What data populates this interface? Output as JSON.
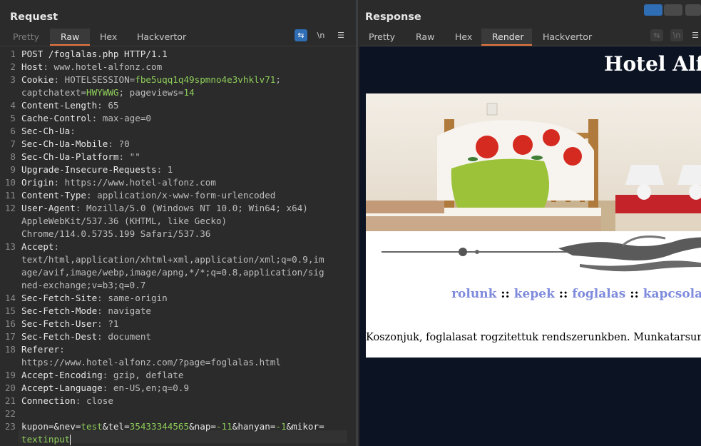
{
  "request": {
    "title": "Request",
    "tabs": [
      "Pretty",
      "Raw",
      "Hex",
      "Hackvertor"
    ],
    "active_tab": "Raw",
    "toolbar": {
      "wrap_icon": "wrap-lines-icon",
      "newline_label": "\\n",
      "menu_icon": "hamburger-menu-icon"
    },
    "lines": [
      {
        "n": "1",
        "segments": [
          {
            "t": "POST /foglalas.php HTTP/1.1",
            "c": "k"
          }
        ]
      },
      {
        "n": "2",
        "segments": [
          {
            "t": "Host",
            "c": "k"
          },
          {
            "t": ": www.hotel-alfonz.com",
            "c": "v"
          }
        ]
      },
      {
        "n": "3",
        "segments": [
          {
            "t": "Cookie",
            "c": "k"
          },
          {
            "t": ": HOTELSESSION=",
            "c": "v"
          },
          {
            "t": "fbe5uqq1q49spmno4e3vhklv71",
            "c": "g"
          },
          {
            "t": ";",
            "c": "v"
          }
        ]
      },
      {
        "n": "",
        "segments": [
          {
            "t": "captchatext=",
            "c": "v"
          },
          {
            "t": "HWYWWG",
            "c": "g"
          },
          {
            "t": "; pageviews=",
            "c": "v"
          },
          {
            "t": "14",
            "c": "g"
          }
        ]
      },
      {
        "n": "4",
        "segments": [
          {
            "t": "Content-Length",
            "c": "k"
          },
          {
            "t": ": 65",
            "c": "v"
          }
        ]
      },
      {
        "n": "5",
        "segments": [
          {
            "t": "Cache-Control",
            "c": "k"
          },
          {
            "t": ": max-age=0",
            "c": "v"
          }
        ]
      },
      {
        "n": "6",
        "segments": [
          {
            "t": "Sec-Ch-Ua",
            "c": "k"
          },
          {
            "t": ":",
            "c": "v"
          }
        ]
      },
      {
        "n": "7",
        "segments": [
          {
            "t": "Sec-Ch-Ua-Mobile",
            "c": "k"
          },
          {
            "t": ": ?0",
            "c": "v"
          }
        ]
      },
      {
        "n": "8",
        "segments": [
          {
            "t": "Sec-Ch-Ua-Platform",
            "c": "k"
          },
          {
            "t": ": \"\"",
            "c": "v"
          }
        ]
      },
      {
        "n": "9",
        "segments": [
          {
            "t": "Upgrade-Insecure-Requests",
            "c": "k"
          },
          {
            "t": ": 1",
            "c": "v"
          }
        ]
      },
      {
        "n": "10",
        "segments": [
          {
            "t": "Origin",
            "c": "k"
          },
          {
            "t": ": https://www.hotel-alfonz.com",
            "c": "v"
          }
        ]
      },
      {
        "n": "11",
        "segments": [
          {
            "t": "Content-Type",
            "c": "k"
          },
          {
            "t": ": application/x-www-form-urlencoded",
            "c": "v"
          }
        ]
      },
      {
        "n": "12",
        "segments": [
          {
            "t": "User-Agent",
            "c": "k"
          },
          {
            "t": ": Mozilla/5.0 (Windows NT 10.0; Win64; x64)",
            "c": "v"
          }
        ]
      },
      {
        "n": "",
        "segments": [
          {
            "t": "AppleWebKit/537.36 (KHTML, like Gecko)",
            "c": "v"
          }
        ]
      },
      {
        "n": "",
        "segments": [
          {
            "t": "Chrome/114.0.5735.199 Safari/537.36",
            "c": "v"
          }
        ]
      },
      {
        "n": "13",
        "segments": [
          {
            "t": "Accept",
            "c": "k"
          },
          {
            "t": ":",
            "c": "v"
          }
        ]
      },
      {
        "n": "",
        "segments": [
          {
            "t": "text/html,application/xhtml+xml,application/xml;q=0.9,im",
            "c": "v"
          }
        ]
      },
      {
        "n": "",
        "segments": [
          {
            "t": "age/avif,image/webp,image/apng,*/*;q=0.8,application/sig",
            "c": "v"
          }
        ]
      },
      {
        "n": "",
        "segments": [
          {
            "t": "ned-exchange;v=b3;q=0.7",
            "c": "v"
          }
        ]
      },
      {
        "n": "14",
        "segments": [
          {
            "t": "Sec-Fetch-Site",
            "c": "k"
          },
          {
            "t": ": same-origin",
            "c": "v"
          }
        ]
      },
      {
        "n": "15",
        "segments": [
          {
            "t": "Sec-Fetch-Mode",
            "c": "k"
          },
          {
            "t": ": navigate",
            "c": "v"
          }
        ]
      },
      {
        "n": "16",
        "segments": [
          {
            "t": "Sec-Fetch-User",
            "c": "k"
          },
          {
            "t": ": ?1",
            "c": "v"
          }
        ]
      },
      {
        "n": "17",
        "segments": [
          {
            "t": "Sec-Fetch-Dest",
            "c": "k"
          },
          {
            "t": ": document",
            "c": "v"
          }
        ]
      },
      {
        "n": "18",
        "segments": [
          {
            "t": "Referer",
            "c": "k"
          },
          {
            "t": ":",
            "c": "v"
          }
        ]
      },
      {
        "n": "",
        "segments": [
          {
            "t": "https://www.hotel-alfonz.com/?page=foglalas.html",
            "c": "v"
          }
        ]
      },
      {
        "n": "19",
        "segments": [
          {
            "t": "Accept-Encoding",
            "c": "k"
          },
          {
            "t": ": gzip, deflate",
            "c": "v"
          }
        ]
      },
      {
        "n": "20",
        "segments": [
          {
            "t": "Accept-Language",
            "c": "k"
          },
          {
            "t": ": en-US,en;q=0.9",
            "c": "v"
          }
        ]
      },
      {
        "n": "21",
        "segments": [
          {
            "t": "Connection",
            "c": "k"
          },
          {
            "t": ": close",
            "c": "v"
          }
        ]
      },
      {
        "n": "22",
        "segments": []
      },
      {
        "n": "23",
        "segments": [
          {
            "t": "kupon=&nev=",
            "c": "k"
          },
          {
            "t": "test",
            "c": "g"
          },
          {
            "t": "&tel=",
            "c": "k"
          },
          {
            "t": "35433344565",
            "c": "g"
          },
          {
            "t": "&nap=",
            "c": "k"
          },
          {
            "t": "-11",
            "c": "g"
          },
          {
            "t": "&hanyan=",
            "c": "k"
          },
          {
            "t": "-1",
            "c": "g"
          },
          {
            "t": "&mikor=",
            "c": "k"
          }
        ]
      },
      {
        "n": "",
        "segments": [
          {
            "t": "textinput",
            "c": "g"
          }
        ],
        "cursor": true
      }
    ]
  },
  "response": {
    "title": "Response",
    "tabs": [
      "Pretty",
      "Raw",
      "Hex",
      "Render",
      "Hackvertor"
    ],
    "active_tab": "Render",
    "render": {
      "site_title": "Hotel Alfo",
      "nav": {
        "items": [
          "rolunk",
          "kepek",
          "foglalas",
          "kapcsolat"
        ],
        "separator": "::"
      },
      "message": "Koszonjuk, foglalasat rogzitettuk rendszerunkben. Munkatarsunk hamaro"
    }
  },
  "colors": {
    "accent": "#e8763f",
    "toggle_on": "#2f6db5",
    "link": "#7f8bdc",
    "param_value": "#8fce5a"
  }
}
